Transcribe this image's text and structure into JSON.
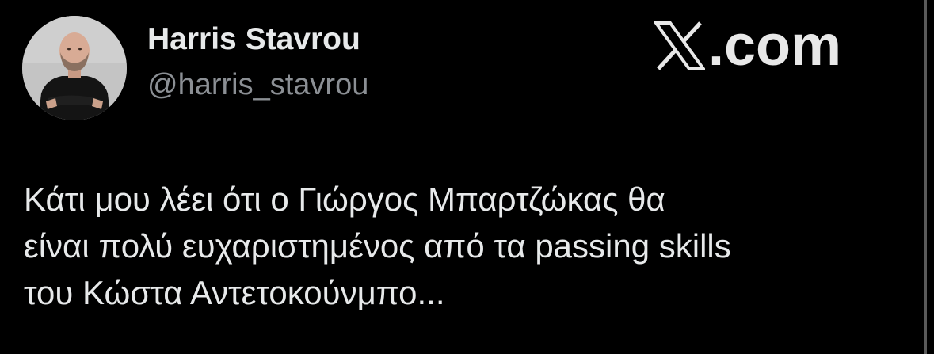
{
  "tweet": {
    "author": {
      "display_name": "Harris Stavrou",
      "handle": "@harris_stavrou",
      "avatar_icon": "profile-photo"
    },
    "brand": {
      "logo_icon": "x-logo-icon",
      "text": ".com"
    },
    "text_lines": [
      "Κάτι μου λέει ότι ο Γιώργος Μπαρτζώκας θα",
      "είναι πολύ ευχαριστημένος από τα passing skills",
      "του Κώστα Αντετοκούνμπο..."
    ]
  },
  "colors": {
    "background": "#000000",
    "primary_text": "#e7e9ea",
    "secondary_text": "#8b8f94"
  }
}
